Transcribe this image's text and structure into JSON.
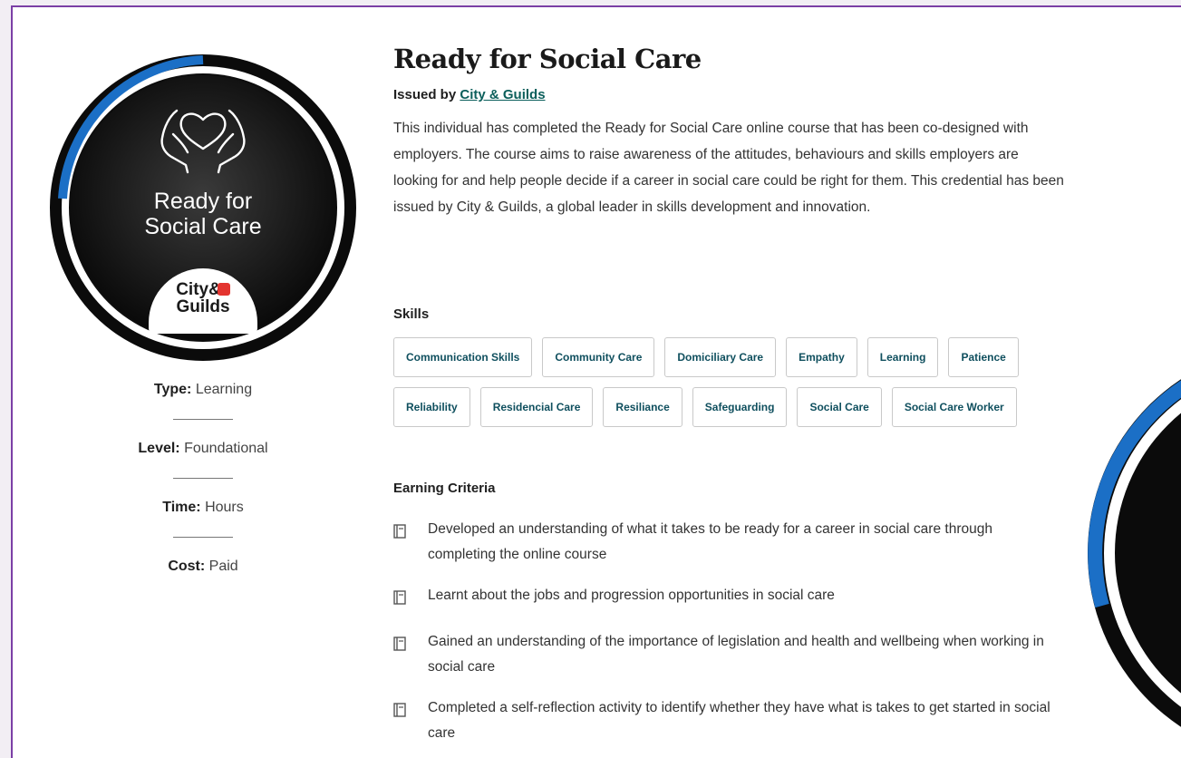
{
  "badge": {
    "title_line1": "Ready for",
    "title_line2": "Social Care",
    "logo_line1": "City&",
    "logo_line2": "Guilds",
    "colors": {
      "ring_blue": "#1b6fc6",
      "ring_dark": "#0b0b0b",
      "logo_red": "#e3342f"
    }
  },
  "meta": [
    {
      "label": "Type:",
      "value": "Learning"
    },
    {
      "label": "Level:",
      "value": "Foundational"
    },
    {
      "label": "Time:",
      "value": "Hours"
    },
    {
      "label": "Cost:",
      "value": "Paid"
    }
  ],
  "title": "Ready for Social Care",
  "issued": {
    "prefix": "Issued by ",
    "issuer": "City & Guilds"
  },
  "description": "This individual has completed the Ready for Social Care online course that has been co-designed with employers. The course aims to raise awareness of the attitudes, behaviours and skills employers are looking for and help people decide if a career in social care could be right for them. This credential has been issued by City & Guilds, a global leader in skills development and innovation.",
  "skills_title": "Skills",
  "skills": [
    [
      "Communication Skills",
      "Community Care",
      "Domiciliary Care",
      "Empathy",
      "Learning",
      "Patience"
    ],
    [
      "Reliability",
      "Residencial Care",
      "Resiliance",
      "Safeguarding",
      "Social Care",
      "Social Care Worker"
    ]
  ],
  "criteria_title": "Earning Criteria",
  "criteria": [
    "Developed an understanding of what it takes to be ready for a career in social care through completing the online course",
    "Learnt about the jobs and progression opportunities in social care",
    "Gained an understanding of the importance of legislation and health and wellbeing when working in social care",
    "Completed a self-reflection activity to identify whether they have what is takes to get started in social care"
  ],
  "icons": {
    "criteria_item": "book-icon",
    "badge_symbol": "heart-hands-icon"
  }
}
